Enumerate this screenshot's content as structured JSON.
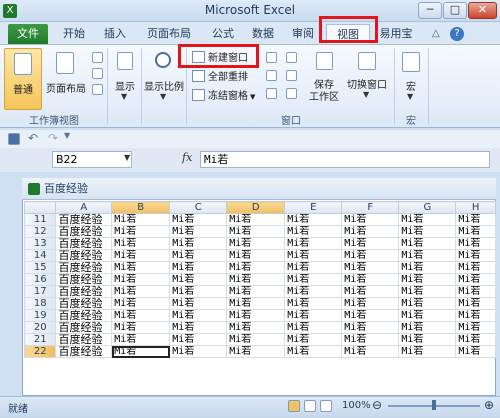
{
  "window": {
    "title": "Microsoft Excel",
    "minimize": "─",
    "maximize": "□",
    "close": "✕"
  },
  "tabs": {
    "file": "文件",
    "home": "开始",
    "insert": "插入",
    "page_layout": "页面布局",
    "formulas": "公式",
    "data": "数据",
    "review": "审阅",
    "view": "视图",
    "addin": "易用宝"
  },
  "ribbon": {
    "normal": "普通",
    "page_layout": "页面布局",
    "show": "显示",
    "zoom": "显示比例",
    "new_window": "新建窗口",
    "arrange_all": "全部重排",
    "freeze_panes": "冻结窗格",
    "save_workspace": "保存",
    "save_workspace_2": "工作区",
    "switch_windows": "切换窗口",
    "macros": "宏",
    "group_views": "工作簿视图",
    "group_window": "窗口",
    "group_macros": "宏"
  },
  "formula_bar": {
    "name_box": "B22",
    "fx": "fx",
    "value": "Mi若"
  },
  "workbook": {
    "title": "百度经验",
    "columns": [
      "A",
      "B",
      "C",
      "D",
      "E",
      "F",
      "G",
      "H"
    ],
    "rows": [
      {
        "num": "11",
        "a": "百度经验",
        "v": "Mi若"
      },
      {
        "num": "12",
        "a": "百度经验",
        "v": "Mi若"
      },
      {
        "num": "13",
        "a": "百度经验",
        "v": "Mi若"
      },
      {
        "num": "14",
        "a": "百度经验",
        "v": "Mi若"
      },
      {
        "num": "15",
        "a": "百度经验",
        "v": "Mi若"
      },
      {
        "num": "16",
        "a": "百度经验",
        "v": "Mi若"
      },
      {
        "num": "17",
        "a": "百度经验",
        "v": "Mi若"
      },
      {
        "num": "18",
        "a": "百度经验",
        "v": "Mi若"
      },
      {
        "num": "19",
        "a": "百度经验",
        "v": "Mi若"
      },
      {
        "num": "20",
        "a": "百度经验",
        "v": "Mi若"
      },
      {
        "num": "21",
        "a": "百度经验",
        "v": "Mi若"
      },
      {
        "num": "22",
        "a": "百度经验",
        "v": "Mi若"
      }
    ]
  },
  "status": {
    "ready": "就绪",
    "zoom": "100%"
  },
  "colors": {
    "highlight_red": "#e0161b",
    "file_tab_green": "#1f7a2b",
    "selected_header": "#f2be5c"
  }
}
